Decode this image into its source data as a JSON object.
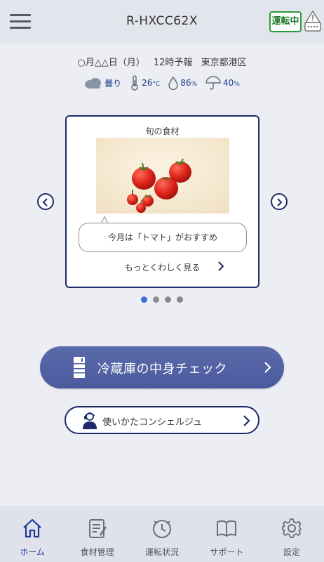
{
  "header": {
    "model": "R-HXCC62X",
    "status": "運転中"
  },
  "forecast": {
    "date": "○月△△日（月）",
    "time": "12時予報",
    "location": "東京都港区"
  },
  "weather": {
    "condition": "曇り",
    "temperature": "26",
    "temperature_unit": "°C",
    "humidity": "86",
    "humidity_unit": "%",
    "rain_chance": "40",
    "rain_unit": "%",
    "icons": [
      "cloud-icon",
      "thermometer-icon",
      "droplet-icon",
      "umbrella-icon"
    ]
  },
  "card": {
    "title": "旬の食材",
    "message": "今月は「トマト」がおすすめ",
    "more_link": "もっとくわしく見る"
  },
  "carousel": {
    "page_count": 4,
    "active_index": 0
  },
  "actions": {
    "primary": "冷蔵庫の中身チェック",
    "secondary": "使いかたコンシェルジュ"
  },
  "nav": {
    "items": [
      {
        "label": "ホーム",
        "icon": "home-icon",
        "active": true
      },
      {
        "label": "食材管理",
        "icon": "food-management-icon",
        "active": false
      },
      {
        "label": "運転状況",
        "icon": "operation-status-icon",
        "active": false
      },
      {
        "label": "サポート",
        "icon": "support-book-icon",
        "active": false
      },
      {
        "label": "設定",
        "icon": "gear-icon",
        "active": false
      }
    ]
  },
  "colors": {
    "accent": "#1d2a6b",
    "primary_button": "#4f5fa1",
    "status_green": "#2e9a3a",
    "active_dot": "#3a6fd8",
    "weather_text": "#1a3c8c"
  }
}
